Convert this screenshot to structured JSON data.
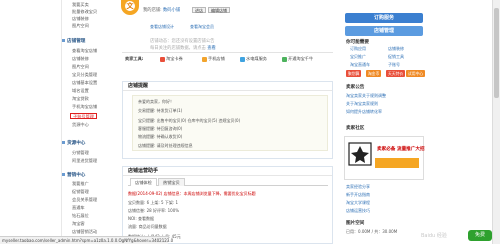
{
  "sidebar": {
    "items_top": [
      "我要买卖",
      "批量修改宝贝",
      "店铺装修",
      "图片空间"
    ],
    "sections": [
      {
        "title": "店铺管理",
        "items": [
          "查看淘宝店铺",
          "店铺装修",
          "图片空间",
          "宝贝分类管理",
          "店铺基本设置",
          "域名设置",
          "淘宝贷款",
          "手机淘宝店铺",
          "子账号管理",
          "货源中心"
        ]
      },
      {
        "title": "货源中心",
        "items": [
          "分销管理",
          "阿里进货管理"
        ]
      },
      {
        "title": "营销中心",
        "items": [
          "我要推广",
          "促销管理",
          "会员关系管理",
          "直通车",
          "钻石展位",
          "淘宝客",
          "店铺营销活动",
          "商家活动"
        ]
      },
      {
        "title": "软件服务",
        "items": [
          "服务中心",
          "我的服务"
        ]
      }
    ],
    "highlighted": "子账号管理"
  },
  "store": {
    "logo_char": "文",
    "shop_label": "我的店铺:",
    "shop_name": "数码小铺",
    "visit_btn": "进店",
    "edit_btn": "编辑店铺",
    "links": [
      "查看店铺设计",
      "查看淘宝会员"
    ],
    "ww_label": "旺旺:",
    "hint": "店铺动态：您还没有设置店铺公告",
    "hint2": "每日关注的店铺数据，请点击",
    "hint_link": "查看",
    "tools_label": "卖家工具:",
    "tools": [
      "淘宝卡券",
      "手机店铺",
      "水电煤服务",
      "开通淘宝千牛"
    ]
  },
  "reminder": {
    "title": "店铺提醒",
    "greeting": "亲爱的卖家，你好！",
    "rows": [
      "交易提醒: 待发货订单(1)",
      "宝贝提醒: 出售中的宝贝(0)    仓库中的宝贝(5)    违规宝贝(0)",
      "客服提醒: 待回复咨询(0)",
      "物流提醒: 待确认收货(0)",
      "店铺提醒: 请及时处理违规信息"
    ]
  },
  "ops": {
    "title": "店铺运营助手",
    "tabs": [
      "店铺体检",
      "热销宝贝"
    ],
    "lines": [
      "数据(2014-09-02) 店铺信息：本周店铺浏览量下降，需要优化宝贝标题",
      "宝贝数量: 6    上架: 5    下架: 1",
      "店铺信誉: 28    好评率: 100%",
      "NOI: 查看数据",
      "流量: 商品访问量数据",
      "数据统计: 上月42   上月: 45元"
    ]
  },
  "right": {
    "btn_main": "订购服务",
    "btn_second": "店铺管理",
    "section1": "你可能需要",
    "links1": [
      "订购应用",
      "店铺装修",
      "宝贝推广",
      "促销工具",
      "淘宝直通车",
      "子账号"
    ],
    "badges": [
      "聚划算",
      "淘金币",
      "天天特价",
      "试用中心"
    ],
    "news_title": "卖家公告",
    "news": [
      "淘宝卖家关于规则调整",
      "关于淘宝卖家规则",
      "如何提升店铺转化率"
    ],
    "ad_text": "卖家必备 流量推广大招",
    "section2": "卖家社区",
    "links2": [
      "卖家经验分享",
      "新手开店指南",
      "淘宝大学课程",
      "店铺运营技巧"
    ],
    "section3": "图片空间",
    "storage": "已用：0.00M / 共：30.00M"
  },
  "status_url": "myseller.taobao.com/seller_admin.htm?spm=a1z0a.1.0.0.OgNfYg&hover=3402123.0",
  "watermark": "Baidu 经验",
  "green_label": "免费"
}
